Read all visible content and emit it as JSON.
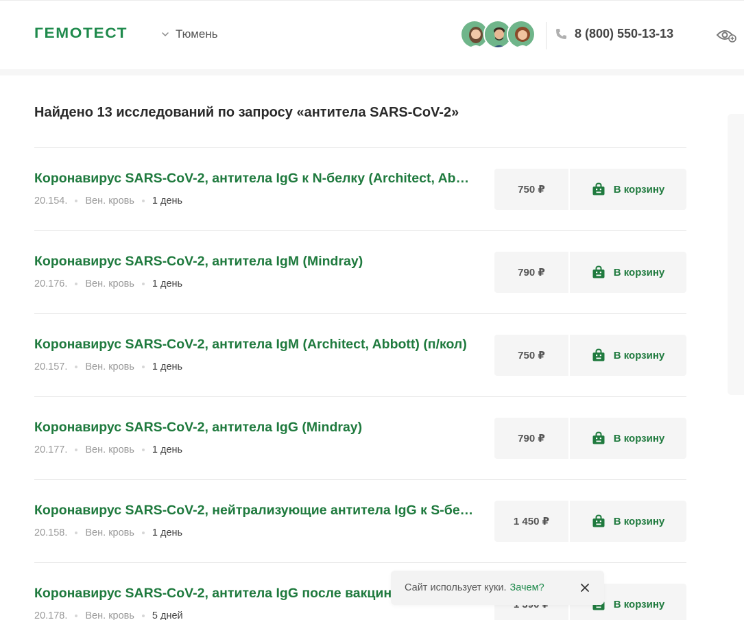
{
  "header": {
    "logo": "ГЕМОТЕСТ",
    "city": "Тюмень",
    "phone": "8 (800) 550-13-13",
    "icons": {
      "city_chevron": "chevron-down-icon",
      "phone": "phone-icon",
      "eye": "eye-plus-icon"
    },
    "avatars": [
      "avatar-woman-1",
      "avatar-man",
      "avatar-woman-2"
    ]
  },
  "main": {
    "result_title": "Найдено 13 исследований по запросу «антитела SARS-CoV-2»",
    "items": [
      {
        "name": "Коронавирус SARS-CoV-2, антитела IgG к N-белку (Architect, Abbott)",
        "code": "20.154.",
        "material": "Вен. кровь",
        "duration": "1 день",
        "price": "750 ₽",
        "cart_label": "В корзину"
      },
      {
        "name": "Коронавирус SARS-CoV-2, антитела IgM (Mindray)",
        "code": "20.176.",
        "material": "Вен. кровь",
        "duration": "1 день",
        "price": "790 ₽",
        "cart_label": "В корзину"
      },
      {
        "name": "Коронавирус SARS-CoV-2, антитела IgM (Architect, Abbott) (п/кол)",
        "code": "20.157.",
        "material": "Вен. кровь",
        "duration": "1 день",
        "price": "750 ₽",
        "cart_label": "В корзину"
      },
      {
        "name": "Коронавирус SARS-CoV-2, антитела IgG (Mindray)",
        "code": "20.177.",
        "material": "Вен. кровь",
        "duration": "1 день",
        "price": "790 ₽",
        "cart_label": "В корзину"
      },
      {
        "name": "Коронавирус SARS-CoV-2, нейтрализующие антитела IgG к S-белку",
        "code": "20.158.",
        "material": "Вен. кровь",
        "duration": "1 день",
        "price": "1 450 ₽",
        "cart_label": "В корзину"
      },
      {
        "name": "Коронавирус SARS-CoV-2, антитела IgG после вакцинации",
        "code": "20.178.",
        "material": "Вен. кровь",
        "duration": "5 дней",
        "price": "1 390 ₽",
        "cart_label": "В корзину"
      }
    ]
  },
  "cookie": {
    "text": "Сайт использует куки.",
    "link": "Зачем?"
  },
  "colors": {
    "brand_green": "#1f7a3e",
    "logo_green": "#1f8a4c",
    "panel_gray": "#f5f5f5"
  }
}
